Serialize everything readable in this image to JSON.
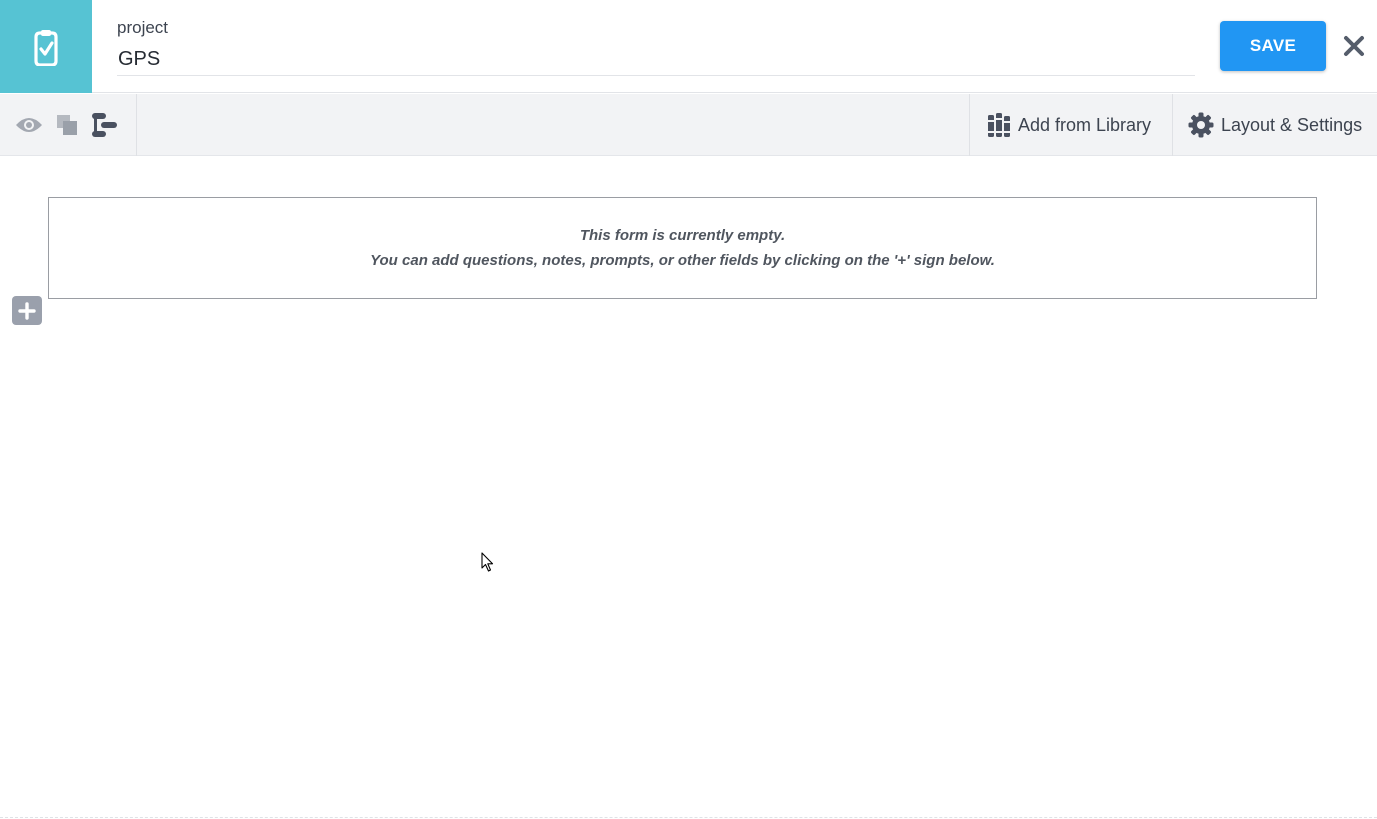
{
  "header": {
    "project_label": "project",
    "project_name": "GPS",
    "save_label": "SAVE",
    "close_icon": "close-icon"
  },
  "toolbar": {
    "view_icons": [
      "eye-icon",
      "copy-icon",
      "logic-icon"
    ],
    "add_from_library": "Add from Library",
    "layout_settings": "Layout & Settings"
  },
  "form": {
    "empty_line1": "This form is currently empty.",
    "empty_line2": "You can add questions, notes, prompts, or other fields by clicking on the '+' sign below."
  },
  "colors": {
    "brand": "#56c3d3",
    "accent": "#2196f3"
  }
}
